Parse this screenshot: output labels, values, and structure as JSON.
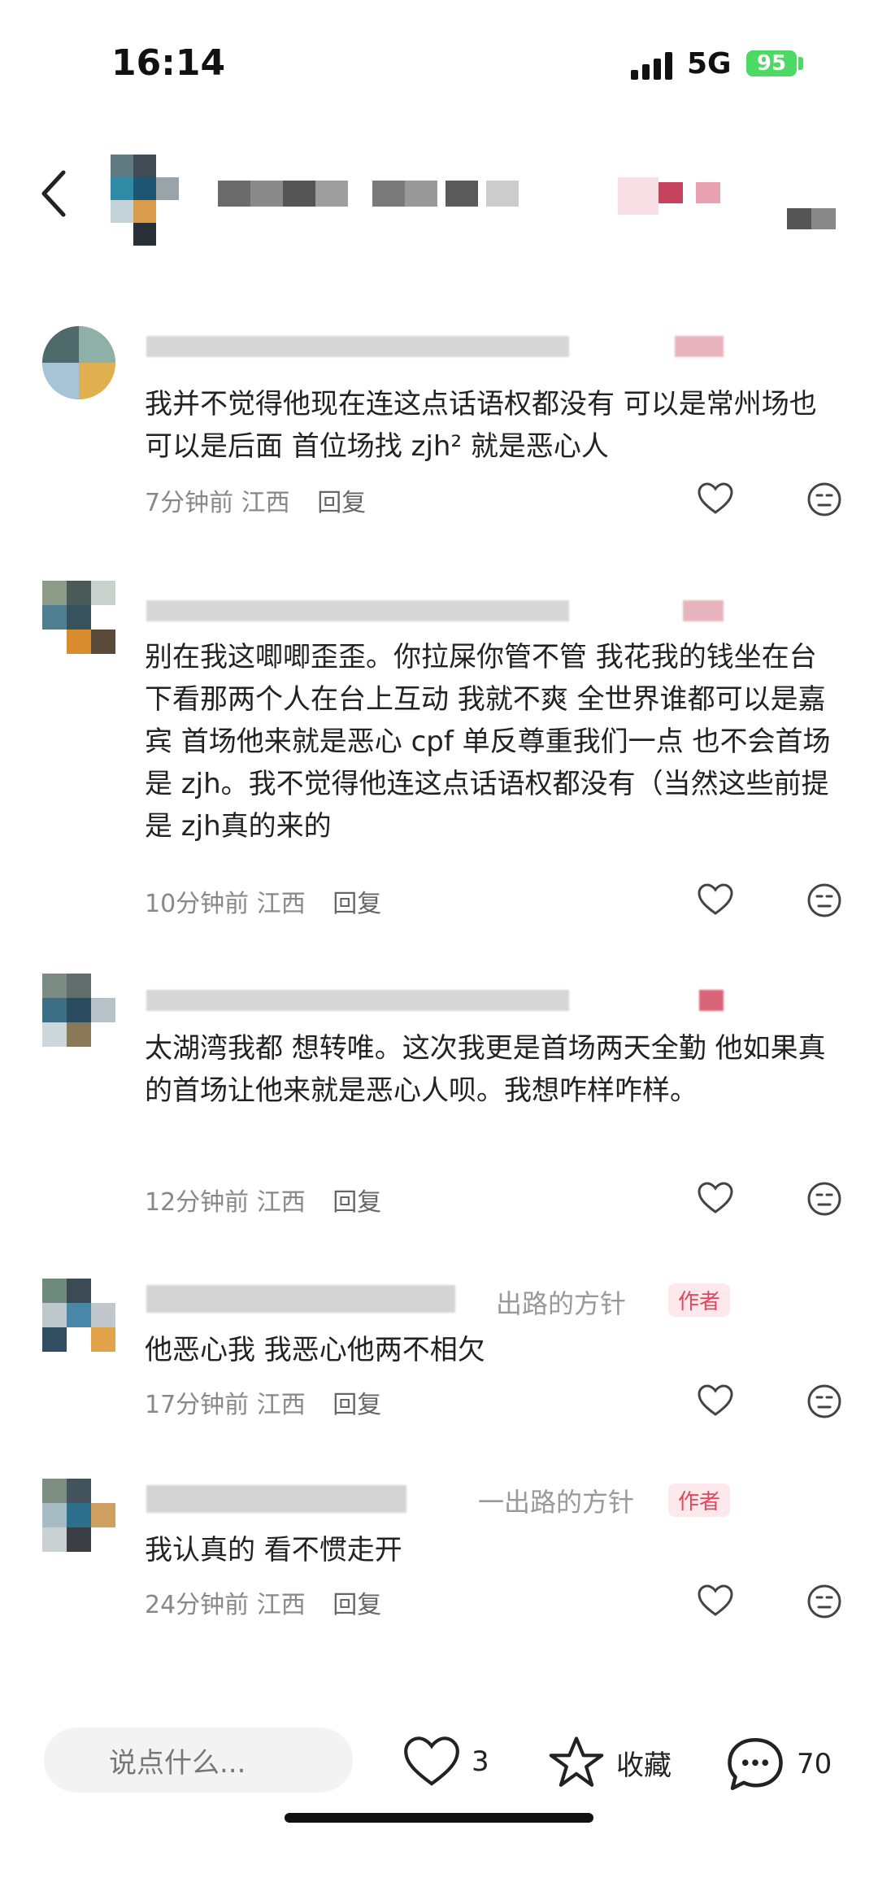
{
  "status_bar": {
    "time": "16:14",
    "network": "5G",
    "battery": "95"
  },
  "comments": [
    {
      "text": "我并不觉得他现在连这点话语权都没有 可以是常州场也可以是后面 首位场找 zjh² 就是恶心人",
      "time": "7分钟前",
      "location": "江西",
      "reply": "回复",
      "is_author": false
    },
    {
      "text": "别在我这唧唧歪歪。你拉屎你管不管 我花我的钱坐在台下看那两个人在台上互动 我就不爽 全世界谁都可以是嘉宾 首场他来就是恶心 cpf 单反尊重我们一点 也不会首场是 zjh。我不觉得他连这点话语权都没有（当然这些前提是 zjh真的来的",
      "time": "10分钟前",
      "location": "江西",
      "reply": "回复",
      "is_author": false
    },
    {
      "text": "太湖湾我都 想转唯。这次我更是首场两天全勤 他如果真的首场让他来就是恶心人呗。我想咋样咋样。",
      "time": "12分钟前",
      "location": "江西",
      "reply": "回复",
      "is_author": false
    },
    {
      "nick_visible": "出路的方针",
      "author_badge": "作者",
      "text": "他恶心我 我恶心他两不相欠",
      "time": "17分钟前",
      "location": "江西",
      "reply": "回复",
      "is_author": true
    },
    {
      "nick_visible": "一出路的方针",
      "author_badge": "作者",
      "text": "我认真的 看不惯走开",
      "time": "24分钟前",
      "location": "江西",
      "reply": "回复",
      "is_author": true
    }
  ],
  "bottom_bar": {
    "input_placeholder": "说点什么...",
    "like_count": "3",
    "collect_label": "收藏",
    "comment_count": "70"
  },
  "icons": [
    "back-icon",
    "heart-icon",
    "dislike-face-icon",
    "star-icon",
    "comment-bubble-icon",
    "signal-icon",
    "battery-icon"
  ],
  "colors": {
    "author_badge_text": "#e2475f",
    "author_badge_bg": "#fde9ec",
    "battery": "#4cd964"
  }
}
